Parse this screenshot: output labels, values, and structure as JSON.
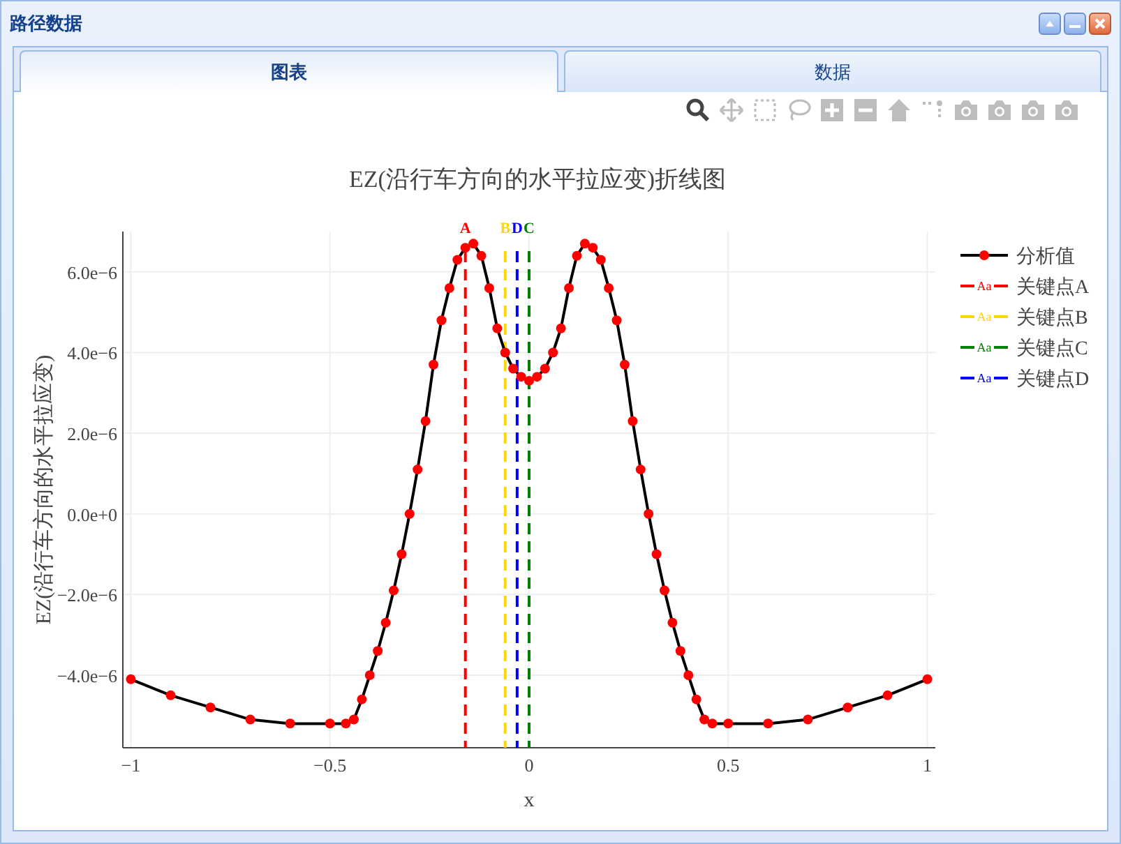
{
  "window": {
    "title": "路径数据",
    "buttons": [
      {
        "kind": "collapse"
      },
      {
        "kind": "minimize"
      },
      {
        "kind": "close"
      }
    ]
  },
  "tabs": [
    {
      "label": "图表",
      "selected": true
    },
    {
      "label": "数据",
      "selected": false
    }
  ],
  "toolbar": [
    {
      "kind": "zoom",
      "selected": true
    },
    {
      "kind": "pan",
      "selected": false
    },
    {
      "kind": "box-select",
      "selected": false
    },
    {
      "kind": "lasso",
      "selected": false
    },
    {
      "kind": "zoom-in",
      "selected": false
    },
    {
      "kind": "zoom-out",
      "selected": false
    },
    {
      "kind": "home",
      "selected": false
    },
    {
      "kind": "spike",
      "selected": false
    },
    {
      "kind": "camera",
      "selected": false
    },
    {
      "kind": "camera",
      "selected": false
    },
    {
      "kind": "camera",
      "selected": false
    },
    {
      "kind": "camera",
      "selected": false
    }
  ],
  "chart_data": {
    "type": "line",
    "title": "EZ(沿行车方向的水平拉应变)折线图",
    "xlabel": "x",
    "ylabel": "EZ(沿行车方向的水平拉应变)",
    "x": [
      -1,
      -0.9,
      -0.8,
      -0.7,
      -0.6,
      -0.5,
      -0.46,
      -0.44,
      -0.42,
      -0.4,
      -0.38,
      -0.36,
      -0.34,
      -0.32,
      -0.3,
      -0.28,
      -0.26,
      -0.24,
      -0.22,
      -0.2,
      -0.18,
      -0.16,
      -0.14,
      -0.12,
      -0.1,
      -0.08,
      -0.06,
      -0.04,
      -0.02,
      0,
      0.02,
      0.04,
      0.06,
      0.08,
      0.1,
      0.12,
      0.14,
      0.16,
      0.18,
      0.2,
      0.22,
      0.24,
      0.26,
      0.28,
      0.3,
      0.32,
      0.34,
      0.36,
      0.38,
      0.4,
      0.42,
      0.44,
      0.46,
      0.5,
      0.6,
      0.7,
      0.8,
      0.9,
      1
    ],
    "grid": true,
    "series": [
      {
        "name": "分析值",
        "color": "#000000",
        "marker": "circle",
        "values": [
          -4.1e-06,
          -4.5e-06,
          -4.8e-06,
          -5.1e-06,
          -5.2e-06,
          -5.2e-06,
          -5.2e-06,
          -5.1e-06,
          -4.6e-06,
          -4e-06,
          -3.4e-06,
          -2.7e-06,
          -1.9e-06,
          -1e-06,
          0.0,
          1.1e-06,
          2.3e-06,
          3.7e-06,
          4.8e-06,
          5.6e-06,
          6.3e-06,
          6.6e-06,
          6.7e-06,
          6.4e-06,
          5.6e-06,
          4.6e-06,
          4e-06,
          3.6e-06,
          3.4e-06,
          3.3e-06,
          3.4e-06,
          3.6e-06,
          4e-06,
          4.6e-06,
          5.6e-06,
          6.4e-06,
          6.7e-06,
          6.6e-06,
          6.3e-06,
          5.6e-06,
          4.8e-06,
          3.7e-06,
          2.3e-06,
          1.1e-06,
          0.0,
          -1e-06,
          -1.9e-06,
          -2.7e-06,
          -3.4e-06,
          -4e-06,
          -4.6e-06,
          -5.1e-06,
          -5.2e-06,
          -5.2e-06,
          -5.2e-06,
          -5.1e-06,
          -4.8e-06,
          -4.5e-06,
          -4.1e-06
        ]
      }
    ],
    "xlim": [
      -1.02,
      1.02
    ],
    "ylim": [
      -5.8e-06,
      7e-06
    ],
    "xticks": [
      {
        "value": -1,
        "label": "−1"
      },
      {
        "value": -0.5,
        "label": "−0.5"
      },
      {
        "value": 0,
        "label": "0"
      },
      {
        "value": 0.5,
        "label": "0.5"
      },
      {
        "value": 1,
        "label": "1"
      }
    ],
    "yticks": [
      {
        "value": -4e-06,
        "label": "−4.0e−6"
      },
      {
        "value": -2e-06,
        "label": "−2.0e−6"
      },
      {
        "value": 0,
        "label": "0.0e+0"
      },
      {
        "value": 2e-06,
        "label": "2.0e−6"
      },
      {
        "value": 4e-06,
        "label": "4.0e−6"
      },
      {
        "value": 6e-06,
        "label": "6.0e−6"
      }
    ],
    "ref_lines": [
      {
        "axis": "x",
        "value": -0.16,
        "label": "A",
        "color": "#ff0000"
      },
      {
        "axis": "x",
        "value": -0.06,
        "label": "B",
        "color": "#ffd700"
      },
      {
        "axis": "x",
        "value": 0,
        "label": "C",
        "color": "#008000"
      },
      {
        "axis": "x",
        "value": -0.03,
        "label": "D",
        "color": "#0000ff"
      }
    ]
  },
  "legend": [
    {
      "kind": "text-symbol",
      "label": "关键点A",
      "symbol": "Aa",
      "color": "#ff0000"
    },
    {
      "kind": "text-symbol",
      "label": "关键点B",
      "symbol": "Aa",
      "color": "#ffd700"
    },
    {
      "kind": "text-symbol",
      "label": "关键点C",
      "symbol": "Aa",
      "color": "#008000"
    },
    {
      "kind": "text-symbol",
      "label": "关键点D",
      "symbol": "Aa",
      "color": "#0000ff"
    }
  ]
}
